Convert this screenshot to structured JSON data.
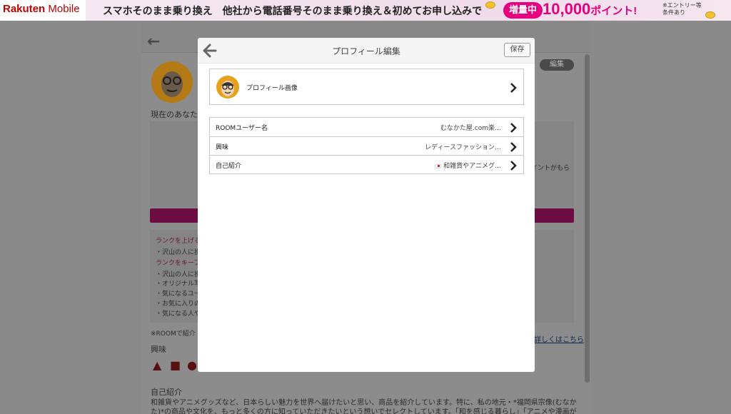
{
  "banner": {
    "logo_brand": "Rakuten",
    "logo_product": "Mobile",
    "promo_text": "スマホそのまま乗り換え　他社から電話番号そのまま乗り換え＆初めてお申し込みで",
    "badge": "増量中",
    "points": "10,000",
    "points_suffix": "ポイント!",
    "note": "※エントリー等 条件あり",
    "brand_color": "#bf0000",
    "accent_color": "#e4007f"
  },
  "background_page": {
    "rank_label": "現在のあなたの",
    "edit_label": "編集",
    "panel_right_text": "イントがもら",
    "tips": [
      {
        "text": "ランクを上げる",
        "style": "red"
      },
      {
        "text": "・沢山の人に投",
        "style": "normal"
      },
      {
        "text": "ランクをキープ",
        "style": "red"
      },
      {
        "text": "・沢山の人に投",
        "style": "normal"
      },
      {
        "text": "・オリジナル写",
        "style": "normal"
      },
      {
        "text": "・気になるユー",
        "style": "normal"
      },
      {
        "text": "・お気に入りの",
        "style": "normal"
      },
      {
        "text": "・気になる人や",
        "style": "normal"
      }
    ],
    "note": "※ROOMで紹介",
    "link": "詳しくはこちら",
    "interest_heading": "興味",
    "bio_heading": "自己紹介",
    "bio_text": "和雑貨やアニメグッズなど、日本らしい魅力を世界へ届けたいと思い、商品を紹介しています。特に、私の地元・*福岡県宗像(むなかた)*の商品や文化を、もっと多くの方に知っていただきたいという想いでセレクトしています。「和を感じる暮らし」「アニメや漫画が"
  },
  "modal": {
    "title": "プロフィール編集",
    "save_label": "保存",
    "image_row_label": "プロフィール画像",
    "rows": [
      {
        "key": "ROOMユーザー名",
        "value": "むなかた屋.com楽…",
        "flag": false
      },
      {
        "key": "興味",
        "value": "レディースファッション…",
        "flag": false
      },
      {
        "key": "自己紹介",
        "value": "和雑貨やアニメグ…",
        "flag": true
      }
    ]
  }
}
